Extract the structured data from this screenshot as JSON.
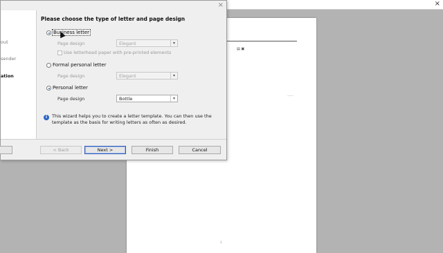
{
  "window": {
    "close_glyph": "×"
  },
  "document": {
    "marker_top": "▤ ▣",
    "marker_right": "———",
    "page_number": "1"
  },
  "dialog": {
    "close_glyph": "×",
    "steps": [
      "out",
      "sender",
      "ation"
    ],
    "active_step_index": 2,
    "heading": "Please choose the type of letter and page design",
    "options": {
      "business": {
        "label": "Business letter",
        "selected": true,
        "page_design_label": "Page design",
        "page_design_value": "Elegant",
        "checkbox_label": "Use letterhead paper with pre-printed elements"
      },
      "formal": {
        "label": "Formal personal letter",
        "selected": false,
        "page_design_label": "Page design",
        "page_design_value": "Elegant"
      },
      "personal": {
        "label": "Personal letter",
        "selected": false,
        "page_design_label": "Page design",
        "page_design_value": "Bottle"
      }
    },
    "info_text": "This wizard helps you to create a letter template. You can then use the template as the basis for writing letters as often as desired.",
    "buttons": {
      "help": "",
      "back": "< Back",
      "next": "Next >",
      "finish": "Finish",
      "cancel": "Cancel"
    }
  }
}
